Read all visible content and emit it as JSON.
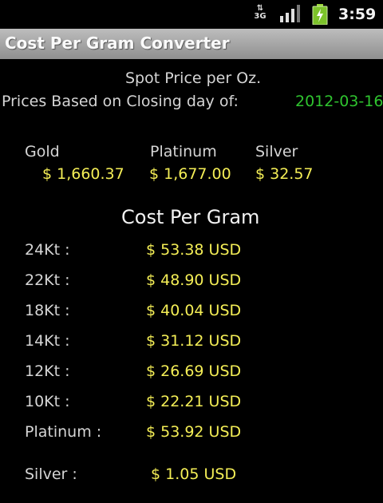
{
  "status_bar": {
    "network_type": "3G",
    "time": "3:59",
    "icons": [
      "network-3g-icon",
      "signal-strength-icon",
      "battery-charging-icon"
    ]
  },
  "app": {
    "title": "Cost Per Gram Converter"
  },
  "spot": {
    "heading": "Spot Price per Oz.",
    "closing_label": "Prices Based on Closing day of:",
    "closing_date": "2012-03-16"
  },
  "metals": [
    {
      "name": "Gold",
      "price": "$ 1,660.37"
    },
    {
      "name": "Platinum",
      "price": "$ 1,677.00"
    },
    {
      "name": "Silver",
      "price": "$ 32.57"
    }
  ],
  "cost_per_gram": {
    "heading": "Cost Per Gram",
    "rows": [
      {
        "label": "24Kt :",
        "value": "$ 53.38 USD"
      },
      {
        "label": "22Kt :",
        "value": "$ 48.90 USD"
      },
      {
        "label": "18Kt :",
        "value": "$ 40.04 USD"
      },
      {
        "label": "14Kt :",
        "value": "$ 31.12 USD"
      },
      {
        "label": "12Kt :",
        "value": "$ 26.69 USD"
      },
      {
        "label": "10Kt :",
        "value": "$ 22.21 USD"
      },
      {
        "label": "Platinum :",
        "value": "$ 53.92 USD"
      },
      {
        "label": "Silver :",
        "value": "$ 1.05 USD"
      }
    ]
  },
  "colors": {
    "value_yellow": "#f4ee56",
    "date_green": "#2fc42f",
    "title_bar": "#a6a6a6"
  }
}
